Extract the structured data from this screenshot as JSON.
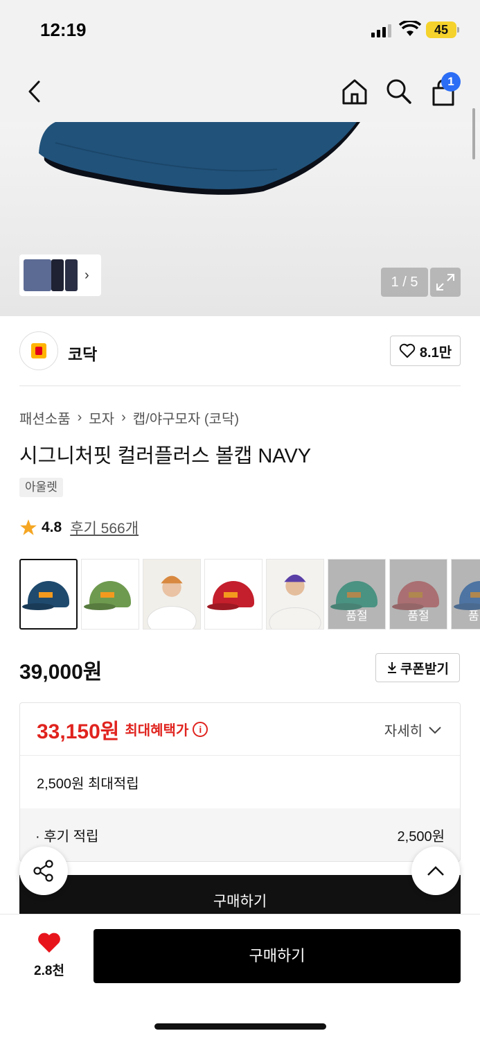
{
  "status_bar": {
    "time": "12:19",
    "battery": "45"
  },
  "gallery": {
    "counter": "1 / 5"
  },
  "brand": {
    "name": "코닥",
    "likes": "8.1만"
  },
  "breadcrumb": [
    "패션소품",
    "모자",
    "캡/야구모자 (코닥)"
  ],
  "product": {
    "title": "시그니처핏 컬러플러스 볼캡 NAVY",
    "tag": "아울렛",
    "rating": "4.8",
    "review_label": "후기 566개",
    "price": "39,000원",
    "coupon_label": "쿠폰받기"
  },
  "color_options": [
    {
      "name": "navy",
      "color": "#1f4a6e",
      "sold_out": ""
    },
    {
      "name": "green",
      "color": "#6e9a4f",
      "sold_out": ""
    },
    {
      "name": "orange-model",
      "color": "#d8893f",
      "sold_out": ""
    },
    {
      "name": "red",
      "color": "#c41f2c",
      "sold_out": ""
    },
    {
      "name": "purple-model",
      "color": "#5a3fa6",
      "sold_out": ""
    },
    {
      "name": "teal",
      "color": "#12b28f",
      "sold_out": "품절"
    },
    {
      "name": "pink",
      "color": "#e7656a",
      "sold_out": "품절"
    },
    {
      "name": "blue",
      "color": "#1a6fd6",
      "sold_out": "품"
    }
  ],
  "benefit": {
    "max_price": "33,150원",
    "max_label": "최대혜택가",
    "detail_label": "자세히",
    "points_total": "2,500원 최대적립",
    "review_points_label": "· 후기 적립",
    "review_points_value": "2,500원"
  },
  "actions": {
    "inline_buy": "구매하기",
    "wish_count": "2.8천",
    "buy": "구매하기"
  },
  "colors": {
    "price_red": "#e0231e",
    "accent_blue": "#2b6df5",
    "button_black": "#000000"
  }
}
